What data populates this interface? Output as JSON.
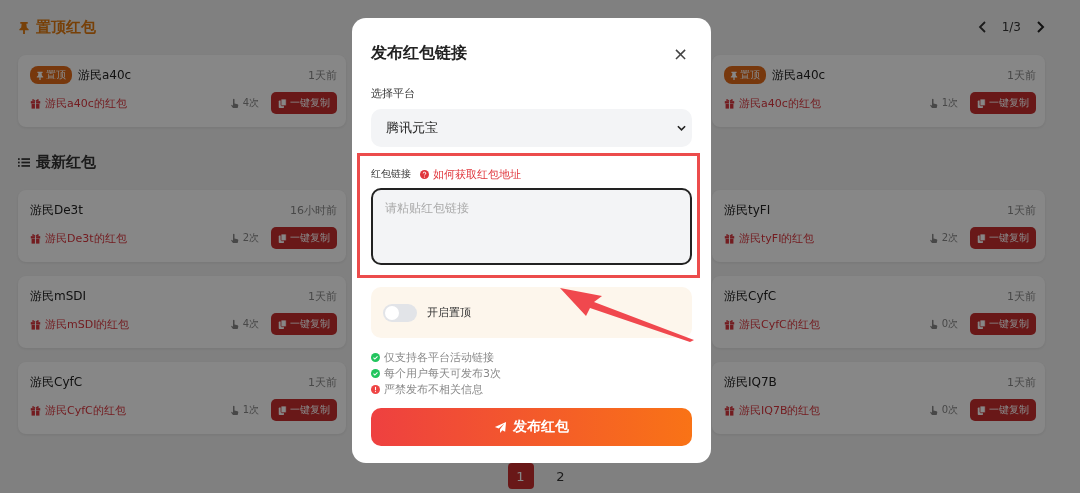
{
  "pinned_section": {
    "title": "置顶红包",
    "page_indicator": "1/3",
    "columns": [
      [
        {
          "badge": "置顶",
          "user": "游民a40c",
          "time": "1天前",
          "packet": "游民a40c的红包",
          "count": "4次",
          "copy_button": "一键复制"
        }
      ],
      [
        {
          "badge": "置顶",
          "user": "游民a40c",
          "time": "1天前",
          "packet": "游民a40c的红包",
          "count": "1次",
          "copy_button": "一键复制"
        }
      ]
    ]
  },
  "latest_section": {
    "title": "最新红包",
    "columns": [
      [
        {
          "user": "游民De3t",
          "time": "16小时前",
          "packet": "游民De3t的红包",
          "count": "2次",
          "copy_button": "一键复制"
        },
        {
          "user": "游民mSDI",
          "time": "1天前",
          "packet": "游民mSDI的红包",
          "count": "4次",
          "copy_button": "一键复制"
        },
        {
          "user": "游民CyfC",
          "time": "1天前",
          "packet": "游民CyfC的红包",
          "count": "1次",
          "copy_button": "一键复制"
        }
      ],
      [
        {
          "user": "游民tyFI",
          "time": "1天前",
          "packet": "游民tyFI的红包",
          "count": "2次",
          "copy_button": "一键复制"
        },
        {
          "user": "游民CyfC",
          "time": "1天前",
          "packet": "游民CyfC的红包",
          "count": "0次",
          "copy_button": "一键复制"
        },
        {
          "user": "游民IQ7B",
          "time": "1天前",
          "packet": "游民IQ7B的红包",
          "count": "0次",
          "copy_button": "一键复制"
        }
      ]
    ]
  },
  "pager": [
    {
      "label": "1",
      "selected": true
    },
    {
      "label": "2",
      "selected": false
    }
  ],
  "dialog": {
    "title": "发布红包链接",
    "close": "×",
    "platform_label": "选择平台",
    "platform_value": "腾讯元宝",
    "link_label": "红包链接",
    "help_link": "如何获取红包地址",
    "link_placeholder": "请粘贴红包链接",
    "pin_toggle": {
      "label": "开启置顶",
      "on": false
    },
    "tips": [
      {
        "kind": "ok",
        "text": "仅支持各平台活动链接"
      },
      {
        "kind": "ok",
        "text": "每个用户每天可发布3次"
      },
      {
        "kind": "warn",
        "text": "严禁发布不相关信息"
      }
    ],
    "submit": "发布红包"
  }
}
